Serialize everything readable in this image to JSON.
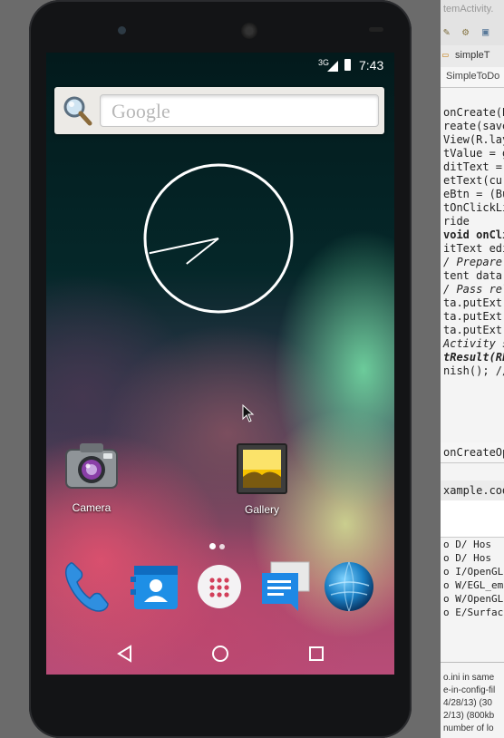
{
  "ide": {
    "top_title": "temActivity.",
    "tab_file": "simpleT",
    "tab_class": "SimpleToDo",
    "code_lines": [
      {
        "text": "onCreate(B",
        "style": "plain"
      },
      {
        "text": "reate(savedI",
        "style": "plain"
      },
      {
        "text": "View(R.layo",
        "style": "plain"
      },
      {
        "text": "tValue = ge",
        "style": "plain"
      },
      {
        "text": "ditText = (",
        "style": "plain"
      },
      {
        "text": "etText(curr",
        "style": "plain"
      },
      {
        "text": "eBtn = (But",
        "style": "plain"
      },
      {
        "text": "tOnClickLis",
        "style": "plain"
      },
      {
        "text": "ride",
        "style": "plain"
      },
      {
        "text": " void onCli",
        "style": "kw"
      },
      {
        "text": "itText edit",
        "style": "plain"
      },
      {
        "text": "/ Prepare da",
        "style": "cm"
      },
      {
        "text": "tent data =",
        "style": "plain"
      },
      {
        "text": "/ Pass relev",
        "style": "cm"
      },
      {
        "text": "ta.putExtra",
        "style": "plain"
      },
      {
        "text": "ta.putExtra",
        "style": "plain"
      },
      {
        "text": "ta.putExtra",
        "style": "plain"
      },
      {
        "text": " Activity s",
        "style": "cm"
      },
      {
        "text": "tResult(RES",
        "style": "mag"
      },
      {
        "text": "nish(); //",
        "style": "plain"
      }
    ],
    "method_label": "onCreateOp",
    "console_tab": "xample.cod",
    "log_lines": [
      {
        "text": "o D/  Hos",
        "style": "plain"
      },
      {
        "text": "o D/  Hos",
        "style": "plain"
      },
      {
        "text": "o I/OpenGL",
        "style": "plain"
      },
      {
        "text": "o W/EGL_em",
        "style": "blue"
      },
      {
        "text": "o W/OpenGL",
        "style": "blue"
      },
      {
        "text": "o E/Surfac",
        "style": "red"
      }
    ],
    "bottom_lines": [
      "o.ini in same",
      "e-in-config-fil",
      "4/28/13) (30",
      "2/13) (800kb",
      "number of lo"
    ]
  },
  "status_bar": {
    "network": "3G",
    "time": "7:43"
  },
  "search_widget": {
    "placeholder": "Google"
  },
  "clock": {
    "hour": 7,
    "minute": 43
  },
  "apps": {
    "camera": "Camera",
    "gallery": "Gallery"
  },
  "dock": [
    "phone-icon",
    "contacts-icon",
    "app-drawer-icon",
    "messaging-icon",
    "browser-icon"
  ],
  "colors": {
    "phone_body": "#131416",
    "accent_blue": "#2f8fe0"
  }
}
